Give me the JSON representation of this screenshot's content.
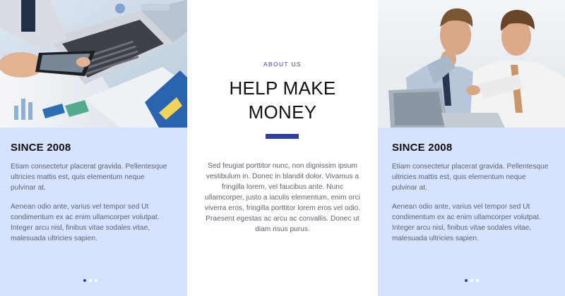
{
  "left_panel": {
    "heading": "SINCE 2008",
    "paragraphs": [
      "Etiam consectetur placerat gravida. Pellentesque ultricies mattis est, quis elementum neque pulvinar at.",
      "Aenean odio ante, varius vel tempor sed Ut condimentum ex ac enim ullamcorper volutpat. Integer arcu nisl, finibus vitae sodales vitae, malesuada ultricies sapien."
    ],
    "carousel": {
      "total": 3,
      "active": 1
    }
  },
  "center_panel": {
    "eyebrow": "ABOUT US",
    "headline_lines": [
      "HELP MAKE",
      "MONEY"
    ],
    "body": "Sed feugiat porttitor nunc, non dignissim ipsum vestibulum in. Donec in blandit dolor. Vivamus a fringilla lorem, vel faucibus ante. Nunc ullamcorper, justo a iaculis elementum, enim orci viverra eros, fringilla porttitor lorem eros vel odio. Praesent egestas ac arcu ac convallis. Donec ut diam risus purus."
  },
  "right_panel": {
    "heading": "SINCE 2008",
    "paragraphs": [
      "Etiam consectetur placerat gravida. Pellentesque ultricies mattis est, quis elementum neque pulvinar at.",
      "Aenean odio ante, varius vel tempor sed Ut condimentum ex ac enim ullamcorper volutpat. Integer arcu nisl, finibus vitae sodales vitae, malesuada ultricies sapien."
    ],
    "carousel": {
      "total": 3,
      "active": 1
    }
  },
  "colors": {
    "card_background": "#d6e2ff",
    "accent": "#2f3f9e",
    "eyebrow": "#3247a5",
    "body_text": "#5f6470",
    "heading_text": "#111111"
  }
}
